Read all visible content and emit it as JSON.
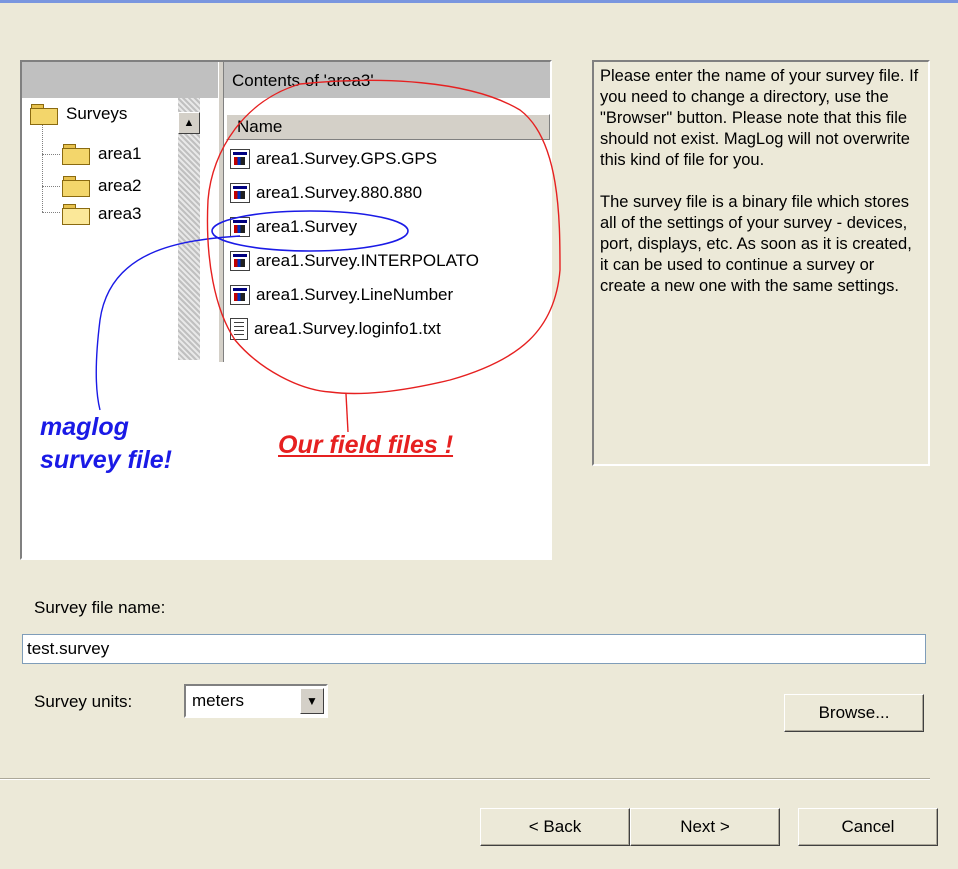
{
  "explorer": {
    "contents_header": "Contents of 'area3'",
    "name_column": "Name",
    "tree": [
      {
        "label": "Surveys"
      },
      {
        "label": "area1"
      },
      {
        "label": "area2"
      },
      {
        "label": "area3"
      }
    ],
    "files": [
      {
        "name": "area1.Survey.GPS.GPS",
        "icon": "exe-icon"
      },
      {
        "name": "area1.Survey.880.880",
        "icon": "exe-icon"
      },
      {
        "name": "area1.Survey",
        "icon": "exe-icon"
      },
      {
        "name": "area1.Survey.INTERPOLATO",
        "icon": "exe-icon"
      },
      {
        "name": "area1.Survey.LineNumber",
        "icon": "exe-icon"
      },
      {
        "name": "area1.Survey.loginfo1.txt",
        "icon": "text-file-icon"
      }
    ]
  },
  "annotations": {
    "maglog_line1": "maglog",
    "maglog_line2": "survey file!",
    "field_files": "Our field files !",
    "blue_color": "#1A1AE6",
    "red_color": "#E62020"
  },
  "help": {
    "paragraph1": "Please enter the name of your survey file. If you need to change a directory, use the \"Browser\" button. Please note that this file should not exist. MagLog will not overwrite this kind of file for you.",
    "paragraph2": "The survey file is a binary file which stores all of the settings of your survey - devices, port, displays, etc. As soon as it is created, it can be used to continue a survey or create a new one with the same settings."
  },
  "form": {
    "file_name_label": "Survey file name:",
    "file_name_value": "test.survey",
    "units_label": "Survey units:",
    "units_value": "meters",
    "browse_label": "Browse..."
  },
  "nav": {
    "back_label": "< Back",
    "next_label": "Next >",
    "cancel_label": "Cancel"
  }
}
